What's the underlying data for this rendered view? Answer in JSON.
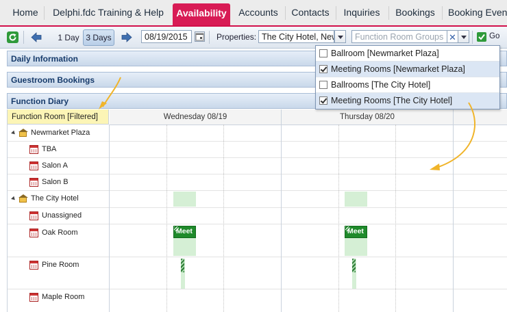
{
  "nav": {
    "tabs": [
      {
        "label": "Home"
      },
      {
        "label": "Delphi.fdc Training & Help"
      },
      {
        "label": "Availability",
        "active": true
      },
      {
        "label": "Accounts"
      },
      {
        "label": "Contacts"
      },
      {
        "label": "Inquiries"
      },
      {
        "label": "Bookings"
      },
      {
        "label": "Booking Even"
      }
    ]
  },
  "toolbar": {
    "one_day_label": "1 Day",
    "three_days_label": "3 Days",
    "date_value": "08/19/2015",
    "properties_label": "Properties:",
    "properties_value": "The City Hotel, New",
    "room_groups_placeholder": "Function Room Groups",
    "go_label": "Go",
    "active_view": "3 Days"
  },
  "panels": {
    "daily_information": "Daily Information",
    "guestroom_bookings": "Guestroom Bookings",
    "function_diary": "Function Diary"
  },
  "grid": {
    "filter_header": "Function Room [Filtered]",
    "days": [
      "Wednesday 08/19",
      "Thursday 08/20"
    ],
    "rows": [
      {
        "label": "Newmarket Plaza",
        "type": "property"
      },
      {
        "label": "TBA",
        "type": "room"
      },
      {
        "label": "Salon A",
        "type": "room"
      },
      {
        "label": "Salon B",
        "type": "room"
      },
      {
        "label": "The City Hotel",
        "type": "property"
      },
      {
        "label": "Unassigned",
        "type": "room"
      },
      {
        "label": "Oak Room",
        "type": "room"
      },
      {
        "label": "Pine Room",
        "type": "room"
      },
      {
        "label": "Maple Room",
        "type": "room"
      }
    ],
    "event_label": "Meet"
  },
  "room_group_options": [
    {
      "label": "Ballroom [Newmarket Plaza]",
      "checked": false
    },
    {
      "label": "Meeting Rooms [Newmarket Plaza]",
      "checked": true
    },
    {
      "label": "Ballrooms [The City Hotel]",
      "checked": false
    },
    {
      "label": "Meeting Rooms [The City Hotel]",
      "checked": true
    }
  ],
  "colors": {
    "nav_active": "#d81b55",
    "panel_text": "#173b6b",
    "event_green": "#1f8a2b",
    "annotation_arrow": "#f0b429",
    "filter_header_bg": "#fcf5b6"
  }
}
